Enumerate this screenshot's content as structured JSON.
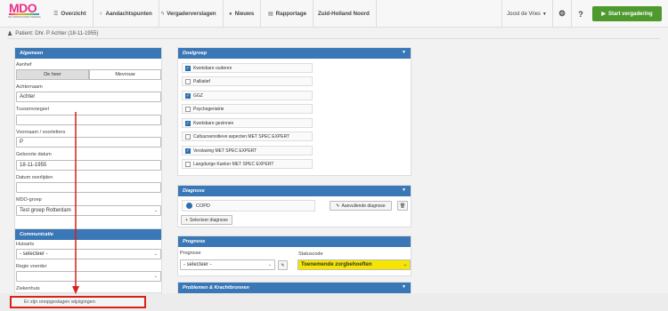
{
  "logo": {
    "mark": "MDO",
    "tagline": "MULTIDISCIPLINAIR OVERLEG"
  },
  "nav": {
    "items": [
      {
        "label": "Overzicht",
        "icon": "list-icon"
      },
      {
        "label": "Aandachtspunten",
        "icon": "bulb-icon"
      },
      {
        "label": "Vergaderverslagen",
        "icon": "bolt-icon"
      },
      {
        "label": "Nieuws",
        "icon": "chat-icon"
      },
      {
        "label": "Rapportage",
        "icon": "table-icon"
      },
      {
        "label": "Zuid-Holland Noord",
        "icon": ""
      }
    ],
    "user": "Joost de Vries",
    "start_label": "Start vergadering"
  },
  "patient": {
    "label": "Patient: Dhr. P Achter (18-11-1955)"
  },
  "algemeen": {
    "title": "Algemeen",
    "aanhef_label": "Aanhef",
    "aanhef_options": [
      "De heer",
      "Mevrouw"
    ],
    "achternaam_label": "Achternaam",
    "achternaam": "Achter",
    "tussenvoegsel_label": "Tussenvoegsel",
    "tussenvoegsel": "",
    "voornaam_label": "Voornaam / voorletters",
    "voornaam": "P",
    "geboortedatum_label": "Geboorte datum",
    "geboortedatum": "18-11-1955",
    "overlijden_label": "Datum overlijden",
    "overlijden": "",
    "groep_label": "MDO-groep",
    "groep": "Test groep Rotterdam"
  },
  "communicatie": {
    "title": "Communicatie",
    "huisarts_label": "Huisarts",
    "huisarts": "- selecteer -",
    "regievoerder_label": "Regie voerder",
    "regievoerder": "",
    "ziekenhuis_label": "Ziekenhuis"
  },
  "doelgroep": {
    "title": "Doelgroep",
    "items": [
      {
        "label": "Kwetsbare ouderen",
        "checked": true
      },
      {
        "label": "Palliatief",
        "checked": false
      },
      {
        "label": "GGZ",
        "checked": true
      },
      {
        "label": "Psychogeriatrie",
        "checked": false
      },
      {
        "label": "Kwetsbare gezinnen",
        "checked": true
      },
      {
        "label": "Cultuursensitieve aspecten MET SPEC EXPERT",
        "checked": false
      },
      {
        "label": "Verslaving MET SPEC EXPERT",
        "checked": true
      },
      {
        "label": "Langdurige Kanker MET SPEC EXPERT",
        "checked": false
      }
    ]
  },
  "diagnose": {
    "title": "Diagnose",
    "item": "COPD",
    "aanvullende_label": "Aanvullende diagnose",
    "select_label": "Selecteer diagnose"
  },
  "prognose": {
    "title": "Prognose",
    "prognose_label": "Prognose",
    "prognose_value": "- selecteer -",
    "statuscode_label": "Statuscode",
    "statuscode_value": "Toenemende zorgbehoeften",
    "statuscode_color": "#f5e500"
  },
  "problemen": {
    "title": "Problemen & Krachtbronnen"
  },
  "statusbar": {
    "message": "Er zijn onopgeslagen wijzigingen"
  },
  "annotation_color": "#d9211b"
}
